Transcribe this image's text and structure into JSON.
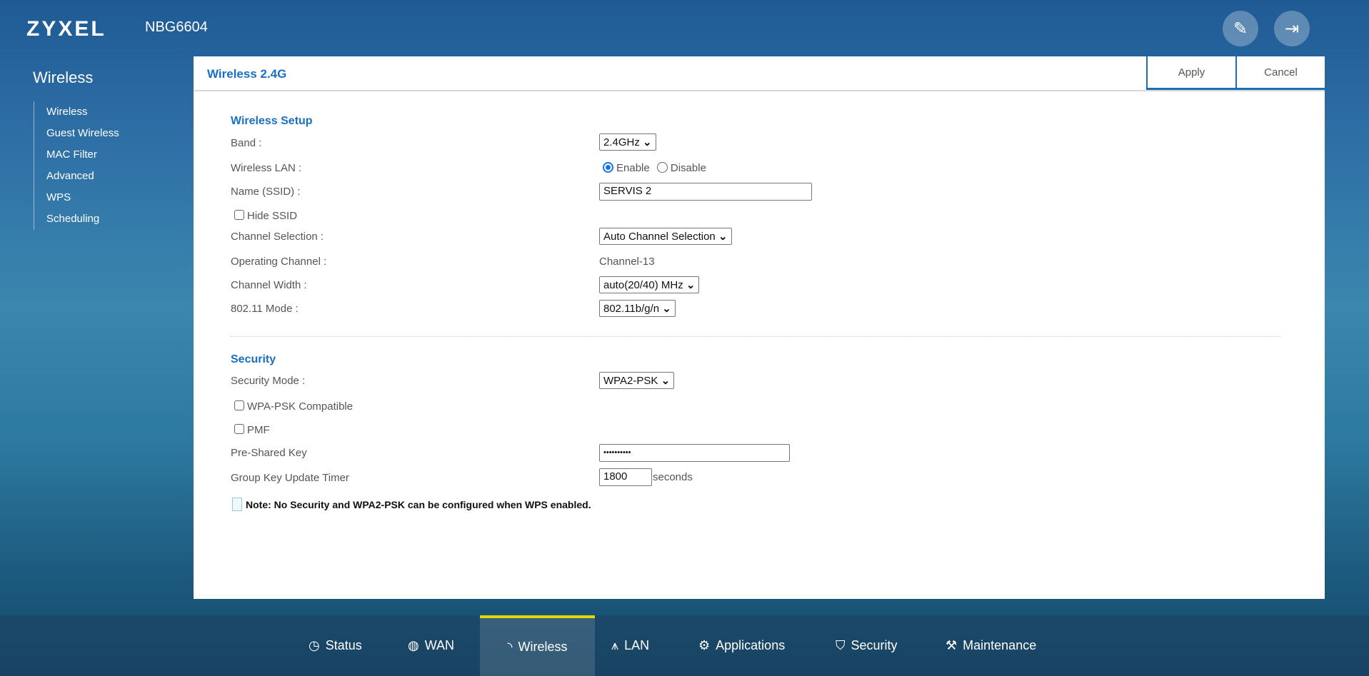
{
  "header": {
    "logo": "ZYXEL",
    "model": "NBG6604"
  },
  "sidebar": {
    "title": "Wireless",
    "items": [
      "Wireless",
      "Guest Wireless",
      "MAC Filter",
      "Advanced",
      "WPS",
      "Scheduling"
    ]
  },
  "panel": {
    "title": "Wireless 2.4G",
    "apply": "Apply",
    "cancel": "Cancel"
  },
  "setup": {
    "title": "Wireless Setup",
    "band_label": "Band :",
    "band_value": "2.4GHz",
    "wlan_label": "Wireless LAN :",
    "enable": "Enable",
    "disable": "Disable",
    "ssid_label": "Name (SSID) :",
    "ssid_value": "SERVIS 2",
    "hide_ssid": "Hide SSID",
    "chansel_label": "Channel Selection :",
    "chansel_value": "Auto Channel Selection",
    "opchan_label": "Operating Channel :",
    "opchan_value": "Channel-13",
    "width_label": "Channel Width :",
    "width_value": "auto(20/40) MHz",
    "mode_label": "802.11 Mode :",
    "mode_value": "802.11b/g/n"
  },
  "security": {
    "title": "Security",
    "mode_label": "Security Mode :",
    "mode_value": "WPA2-PSK",
    "wpa_compat": "WPA-PSK Compatible",
    "pmf": "PMF",
    "psk_label": "Pre-Shared Key",
    "psk_value": "••••••••••",
    "timer_label": "Group Key Update Timer",
    "timer_value": "1800",
    "timer_unit": "seconds",
    "note": "Note: No Security and WPA2-PSK can be configured when WPS enabled."
  },
  "nav": [
    "Status",
    "WAN",
    "Wireless",
    "LAN",
    "Applications",
    "Security",
    "Maintenance"
  ],
  "colors": {
    "accent": "#1a6fc1",
    "active_tab": "#e5d600"
  }
}
